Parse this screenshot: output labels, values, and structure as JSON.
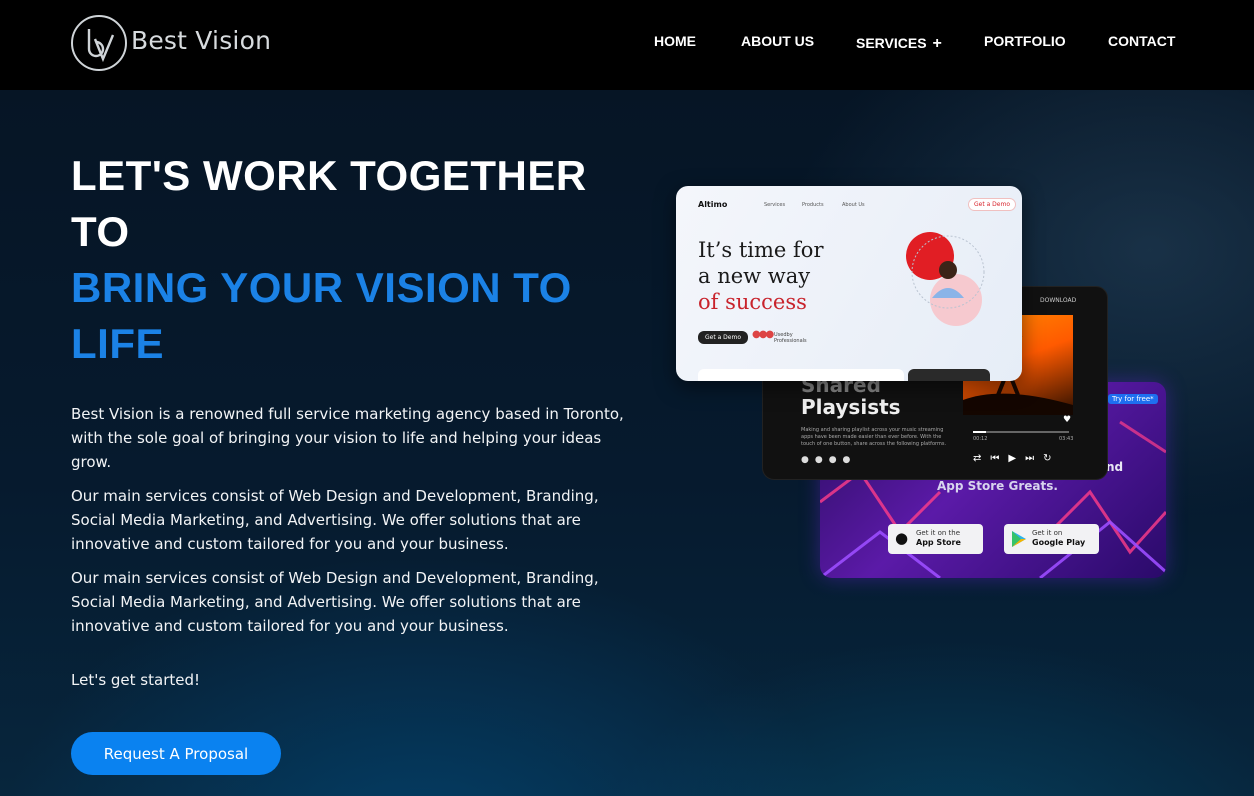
{
  "header": {
    "brand": "Best Vision",
    "nav": [
      "HOME",
      "ABOUT US",
      "SERVICES",
      "PORTFOLIO",
      "CONTACT"
    ],
    "services_plus": "+"
  },
  "hero": {
    "line1": "LET'S WORK TOGETHER",
    "line2": "TO",
    "line3": "BRING YOUR VISION TO",
    "line4": "LIFE",
    "para1": "Best Vision is a renowned full service marketing agency based in Toronto, with the sole goal of bringing your vision to life and helping your ideas grow.",
    "para2": "Our main services consist of Web Design and Development, Branding, Social Media Marketing, and Advertising. We offer solutions that are innovative and custom tailored for you and your business.",
    "para3": "Our main services consist of Web Design and Development, Branding, Social Media Marketing, and Advertising. We offer solutions that are innovative and custom tailored for you and your business.",
    "cta_text": "Let's get started!",
    "button": "Request A Proposal"
  },
  "mockups": {
    "altimo": {
      "brand": "Altimo",
      "nav": [
        "Services",
        "Products",
        "About Us"
      ],
      "demo": "Get a Demo",
      "headline1": "It’s time for",
      "headline2": "a new way",
      "headline3": "of success",
      "pill": "Get a Demo",
      "badge": "Usedby Professionals"
    },
    "music": {
      "download": "DOWNLOAD",
      "title1": "Shared",
      "title2": "Playsists",
      "desc": "Making and sharing playlist across your music streaming apps have been made easier than ever before. With the touch of one button, share across the following platforms.",
      "time_start": "00:12",
      "time_end": "03:43"
    },
    "app": {
      "badge": "Try for free*",
      "tag": "nd",
      "subtitle": "App Store Greats.",
      "store1_small": "Get it on the",
      "store1_big": "App Store",
      "store2_small": "Get it on",
      "store2_big": "Google Play"
    }
  },
  "colors": {
    "accent": "#0a82f0",
    "heading_blue": "#1b82e6",
    "header_bg": "#000000"
  }
}
